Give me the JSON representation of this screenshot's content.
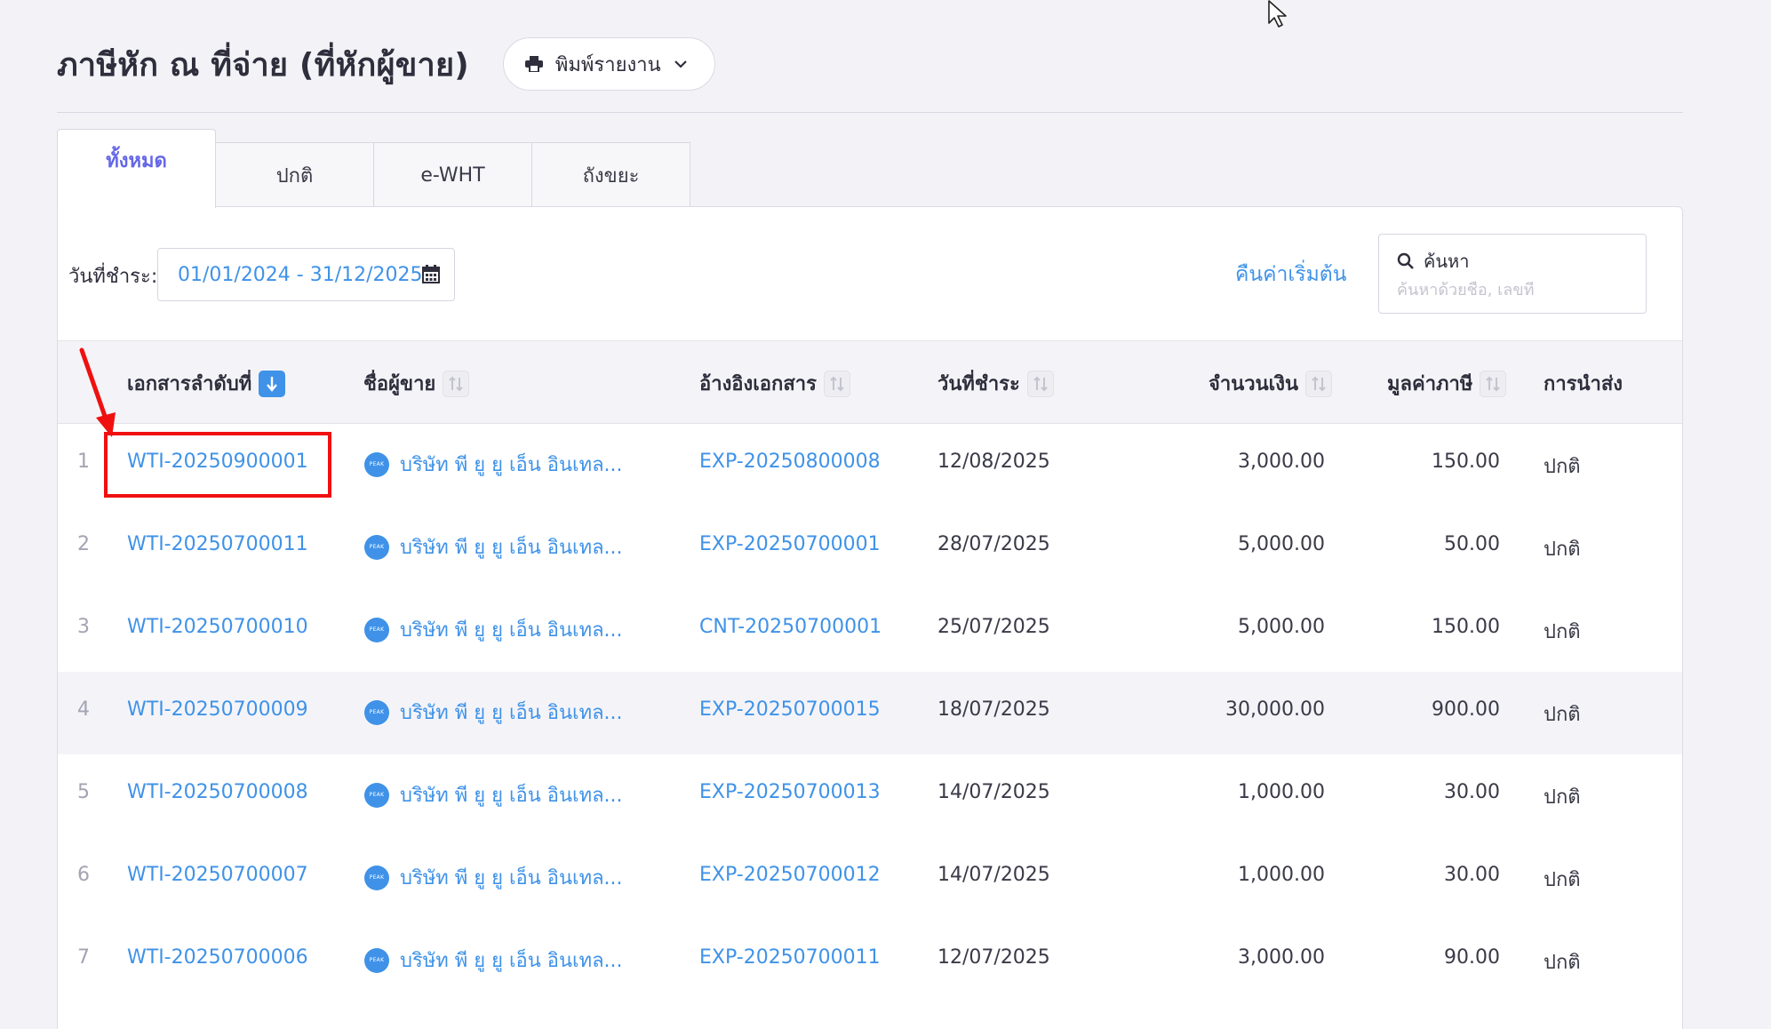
{
  "header": {
    "title": "ภาษีหัก ณ ที่จ่าย (ที่หักผู้ขาย)",
    "print_button_label": "พิมพ์รายงาน",
    "print_icon": "printer-icon",
    "dropdown_icon": "chevron-down-icon"
  },
  "tabs": [
    {
      "label": "ทั้งหมด",
      "active": true
    },
    {
      "label": "ปกติ",
      "active": false
    },
    {
      "label": "e-WHT",
      "active": false
    },
    {
      "label": "ถังขยะ",
      "active": false
    }
  ],
  "filters": {
    "date_label": "วันที่ชำระ:",
    "date_range": "01/01/2024 - 31/12/2025",
    "calendar_icon": "calendar-icon",
    "reset_label": "คืนค่าเริ่มต้น"
  },
  "search": {
    "title": "ค้นหา",
    "placeholder": "ค้นหาด้วยชื่อ, เลขที่",
    "icon": "search-icon"
  },
  "table": {
    "columns": [
      "เอกสารลำดับที่",
      "ชื่อผู้ขาย",
      "อ้างอิงเอกสาร",
      "วันที่ชำระ",
      "จำนวนเงิน",
      "มูลค่าภาษี",
      "การนำส่ง"
    ],
    "vendor_logo_text": "PEAK",
    "rows": [
      {
        "index": "1",
        "doc": "WTI-20250900001",
        "vendor": "บริษัท พี ยู ยู เอ็น อินเทล...",
        "ref": "EXP-20250800008",
        "date": "12/08/2025",
        "amount": "3,000.00",
        "tax": "150.00",
        "delivery": "ปกติ"
      },
      {
        "index": "2",
        "doc": "WTI-20250700011",
        "vendor": "บริษัท พี ยู ยู เอ็น อินเทล...",
        "ref": "EXP-20250700001",
        "date": "28/07/2025",
        "amount": "5,000.00",
        "tax": "50.00",
        "delivery": "ปกติ"
      },
      {
        "index": "3",
        "doc": "WTI-20250700010",
        "vendor": "บริษัท พี ยู ยู เอ็น อินเทล...",
        "ref": "CNT-20250700001",
        "date": "25/07/2025",
        "amount": "5,000.00",
        "tax": "150.00",
        "delivery": "ปกติ"
      },
      {
        "index": "4",
        "doc": "WTI-20250700009",
        "vendor": "บริษัท พี ยู ยู เอ็น อินเทล...",
        "ref": "EXP-20250700015",
        "date": "18/07/2025",
        "amount": "30,000.00",
        "tax": "900.00",
        "delivery": "ปกติ"
      },
      {
        "index": "5",
        "doc": "WTI-20250700008",
        "vendor": "บริษัท พี ยู ยู เอ็น อินเทล...",
        "ref": "EXP-20250700013",
        "date": "14/07/2025",
        "amount": "1,000.00",
        "tax": "30.00",
        "delivery": "ปกติ"
      },
      {
        "index": "6",
        "doc": "WTI-20250700007",
        "vendor": "บริษัท พี ยู ยู เอ็น อินเทล...",
        "ref": "EXP-20250700012",
        "date": "14/07/2025",
        "amount": "1,000.00",
        "tax": "30.00",
        "delivery": "ปกติ"
      },
      {
        "index": "7",
        "doc": "WTI-20250700006",
        "vendor": "บริษัท พี ยู ยู เอ็น อินเทล...",
        "ref": "EXP-20250700011",
        "date": "12/07/2025",
        "amount": "3,000.00",
        "tax": "90.00",
        "delivery": "ปกติ"
      }
    ]
  },
  "colors": {
    "accent_blue": "#3f92e8",
    "active_tab": "#6467e6",
    "annotation_red": "#f01010"
  }
}
